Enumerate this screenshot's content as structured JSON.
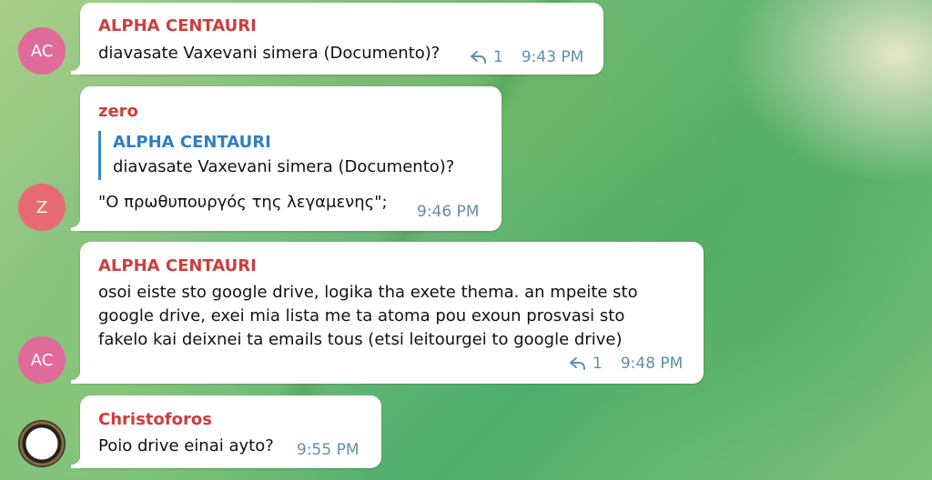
{
  "messages": [
    {
      "avatar": "AC",
      "sender": "ALPHA CENTAURI",
      "lines": [
        "diavasate Vaxevani simera (Documento)?"
      ],
      "reply_count": "1",
      "time": "9:43 PM"
    },
    {
      "avatar": "Z",
      "sender": "zero",
      "quote": {
        "sender": "ALPHA CENTAURI",
        "text": "diavasate Vaxevani simera (Documento)?"
      },
      "lines": [
        "\"Ο πρωθυπουργός της λεγαμενης\";"
      ],
      "time": "9:46 PM"
    },
    {
      "avatar": "AC",
      "sender": "ALPHA CENTAURI",
      "lines": [
        "osoi eiste sto google drive, logika tha exete thema. an mpeite sto",
        "google drive, exei mia lista me ta atoma pou exoun prosvasi sto",
        "fakelo kai deixnei ta emails tous (etsi leitourgei to google drive)"
      ],
      "reply_count": "1",
      "time": "9:48 PM"
    },
    {
      "sender": "Christoforos",
      "lines": [
        "Poio drive einai ayto?"
      ],
      "time": "9:55 PM"
    }
  ],
  "icons": {
    "reply": "reply-arrow-icon"
  },
  "colors": {
    "sender_red": "#cf3d3d",
    "quote_blue": "#2f7fc1",
    "meta_blue": "#5f8fa6",
    "avatar_ac": "#e06a9a",
    "avatar_z": "#e86b73"
  }
}
